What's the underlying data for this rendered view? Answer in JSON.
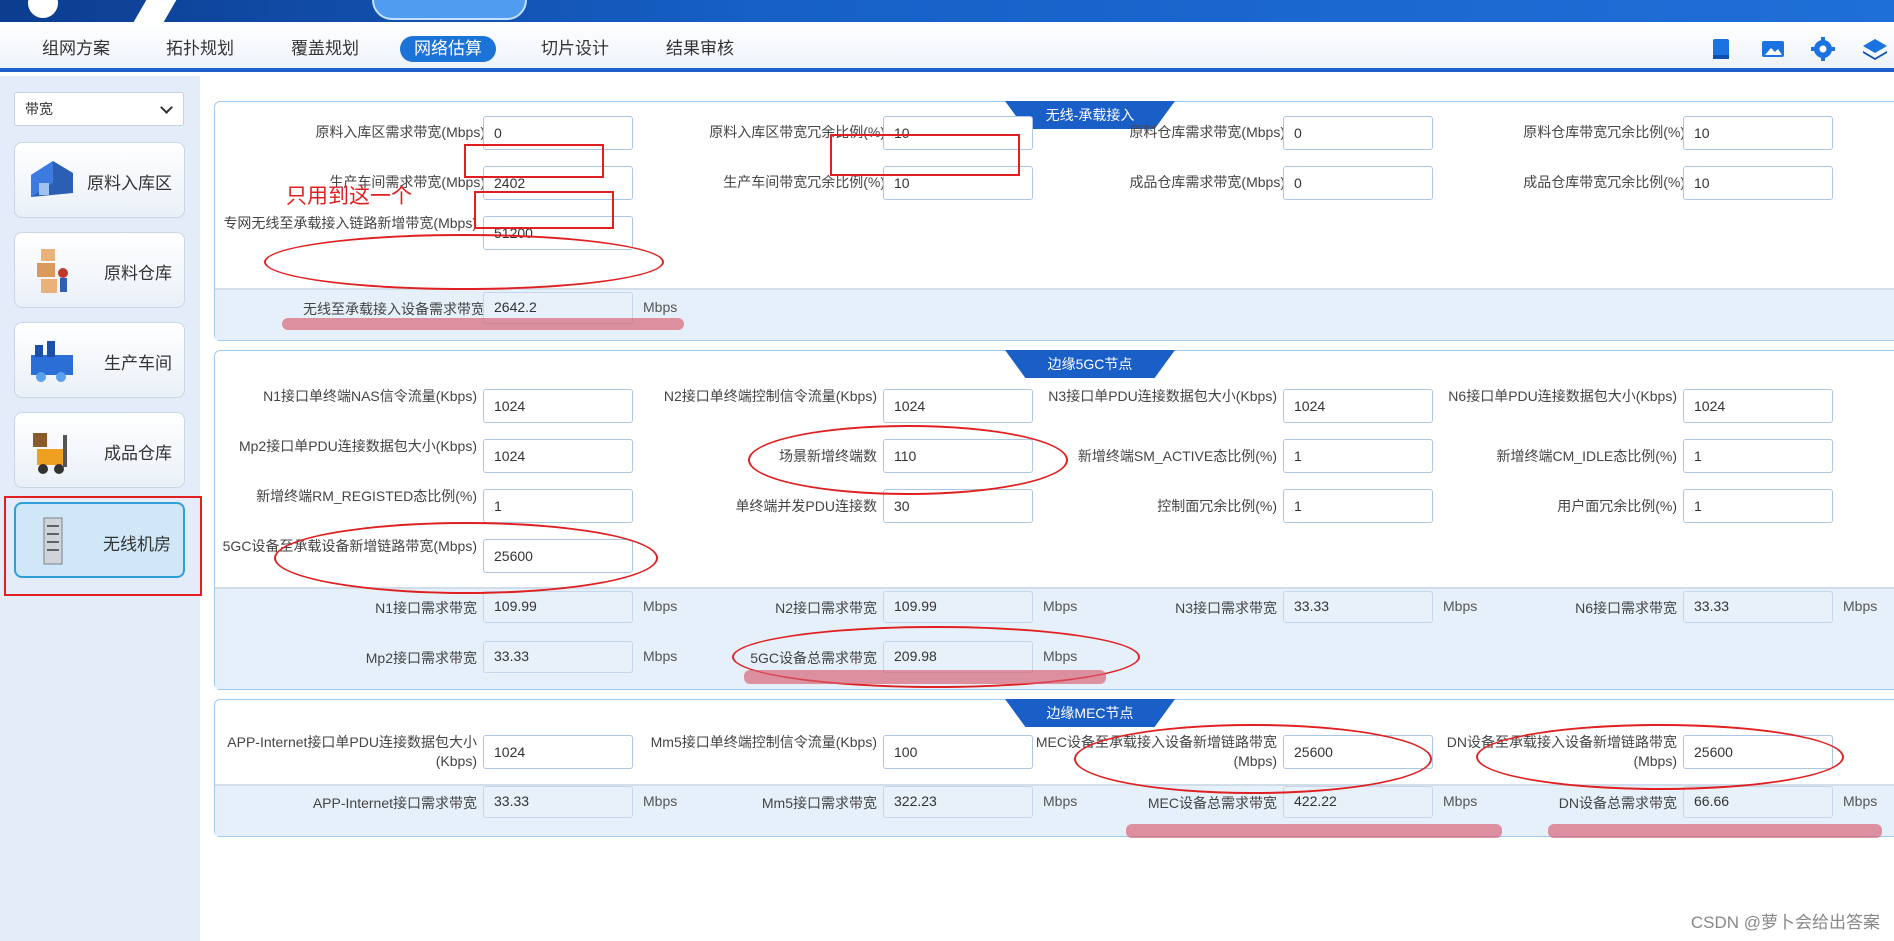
{
  "nav": {
    "tabs": [
      "组网方案",
      "拓扑规划",
      "覆盖规划",
      "网络估算",
      "切片设计",
      "结果审核"
    ],
    "active_tab": "网络估算",
    "icons": [
      "book-icon",
      "image-icon",
      "gear-icon",
      "layers-icon"
    ]
  },
  "sidebar": {
    "select_value": "带宽",
    "items": [
      {
        "label": "原料入库区",
        "icon": "warehouse-icon"
      },
      {
        "label": "原料仓库",
        "icon": "boxes-icon"
      },
      {
        "label": "生产车间",
        "icon": "factory-icon"
      },
      {
        "label": "成品仓库",
        "icon": "forklift-icon"
      },
      {
        "label": "无线机房",
        "icon": "server-rack-icon"
      }
    ],
    "active_item": "无线机房"
  },
  "sections": {
    "wireless": {
      "title": "无线-承载接入",
      "fields": [
        {
          "label": "原料入库区需求带宽(Mbps)",
          "value": "0"
        },
        {
          "label": "原料入库区带宽冗余比例(%)",
          "value": "10"
        },
        {
          "label": "原料仓库需求带宽(Mbps)",
          "value": "0"
        },
        {
          "label": "原料仓库带宽冗余比例(%)",
          "value": "10"
        },
        {
          "label": "生产车间需求带宽(Mbps)",
          "value": "2402"
        },
        {
          "label": "生产车间带宽冗余比例(%)",
          "value": "10"
        },
        {
          "label": "成品仓库需求带宽(Mbps)",
          "value": "0"
        },
        {
          "label": "成品仓库带宽冗余比例(%)",
          "value": "10"
        },
        {
          "label": "专网无线至承载接入链路新增带宽(Mbps)",
          "value": "51200"
        }
      ],
      "results": [
        {
          "label": "无线至承载接入设备需求带宽",
          "value": "2642.2",
          "unit": "Mbps"
        }
      ]
    },
    "edge5gc": {
      "title": "边缘5GC节点",
      "fields": [
        {
          "label": "N1接口单终端NAS信令流量(Kbps)",
          "value": "1024"
        },
        {
          "label": "N2接口单终端控制信令流量(Kbps)",
          "value": "1024"
        },
        {
          "label": "N3接口单PDU连接数据包大小(Kbps)",
          "value": "1024"
        },
        {
          "label": "N6接口单PDU连接数据包大小(Kbps)",
          "value": "1024"
        },
        {
          "label": "Mp2接口单PDU连接数据包大小(Kbps)",
          "value": "1024"
        },
        {
          "label": "场景新增终端数",
          "value": "110"
        },
        {
          "label": "新增终端SM_ACTIVE态比例(%)",
          "value": "1"
        },
        {
          "label": "新增终端CM_IDLE态比例(%)",
          "value": "1"
        },
        {
          "label": "新增终端RM_REGISTED态比例(%)",
          "value": "1"
        },
        {
          "label": "单终端并发PDU连接数",
          "value": "30"
        },
        {
          "label": "控制面冗余比例(%)",
          "value": "1"
        },
        {
          "label": "用户面冗余比例(%)",
          "value": "1"
        },
        {
          "label": "5GC设备至承载设备新增链路带宽(Mbps)",
          "value": "25600"
        }
      ],
      "results": [
        {
          "label": "N1接口需求带宽",
          "value": "109.99",
          "unit": "Mbps"
        },
        {
          "label": "N2接口需求带宽",
          "value": "109.99",
          "unit": "Mbps"
        },
        {
          "label": "N3接口需求带宽",
          "value": "33.33",
          "unit": "Mbps"
        },
        {
          "label": "N6接口需求带宽",
          "value": "33.33",
          "unit": "Mbps"
        },
        {
          "label": "Mp2接口需求带宽",
          "value": "33.33",
          "unit": "Mbps"
        },
        {
          "label": "5GC设备总需求带宽",
          "value": "209.98",
          "unit": "Mbps"
        }
      ]
    },
    "edgemec": {
      "title": "边缘MEC节点",
      "fields": [
        {
          "label": "APP-Internet接口单PDU连接数据包大小(Kbps)",
          "value": "1024"
        },
        {
          "label": "Mm5接口单终端控制信令流量(Kbps)",
          "value": "100"
        },
        {
          "label": "MEC设备至承载接入设备新增链路带宽(Mbps)",
          "value": "25600"
        },
        {
          "label": "DN设备至承载接入设备新增链路带宽(Mbps)",
          "value": "25600"
        }
      ],
      "results": [
        {
          "label": "APP-Internet接口需求带宽",
          "value": "33.33",
          "unit": "Mbps"
        },
        {
          "label": "Mm5接口需求带宽",
          "value": "322.23",
          "unit": "Mbps"
        },
        {
          "label": "MEC设备总需求带宽",
          "value": "422.22",
          "unit": "Mbps"
        },
        {
          "label": "DN设备总需求带宽",
          "value": "66.66",
          "unit": "Mbps"
        }
      ]
    }
  },
  "annotation_note": "只用到这一个",
  "watermark": "CSDN @萝卜会给出答案"
}
